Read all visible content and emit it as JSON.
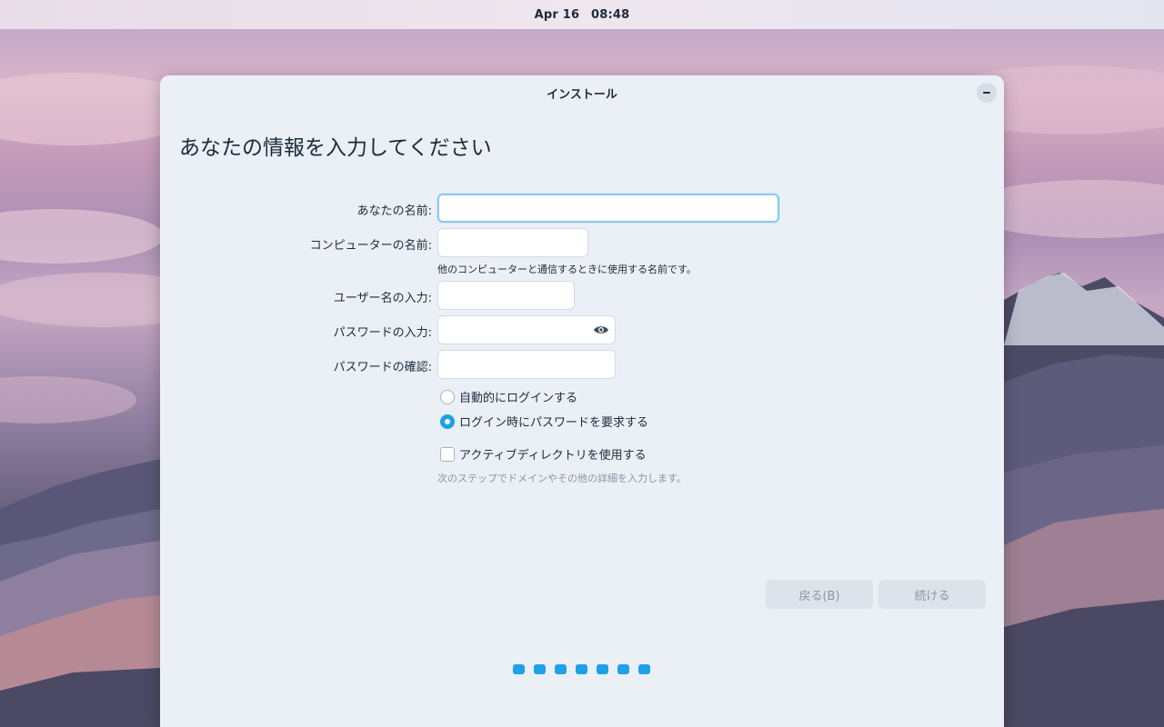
{
  "topbar": {
    "date": "Apr 16",
    "time": "08:48"
  },
  "window": {
    "title": "インストール",
    "heading": "あなたの情報を入力してください"
  },
  "form": {
    "name_label": "あなたの名前:",
    "name_value": "",
    "computer_label": "コンピューターの名前:",
    "computer_value": "",
    "computer_hint": "他のコンピューターと通信するときに使用する名前です。",
    "username_label": "ユーザー名の入力:",
    "username_value": "",
    "password_label": "パスワードの入力:",
    "password_value": "",
    "confirm_label": "パスワードの確認:",
    "confirm_value": "",
    "auto_login_label": "自動的にログインする",
    "require_password_label": "ログイン時にパスワードを要求する",
    "selected_login_option": "require_password",
    "active_directory_label": "アクティブディレクトリを使用する",
    "active_directory_checked": false,
    "active_directory_hint": "次のステップでドメインやその他の詳細を入力します。"
  },
  "buttons": {
    "back": "戻る(B)",
    "continue": "続ける"
  },
  "progress": {
    "total_steps": 7
  },
  "colors": {
    "accent": "#1ea1e8",
    "window_bg": "#ebf0f7"
  },
  "icons": {
    "password_toggle": "eye-icon",
    "minimize": "minimize-icon"
  }
}
